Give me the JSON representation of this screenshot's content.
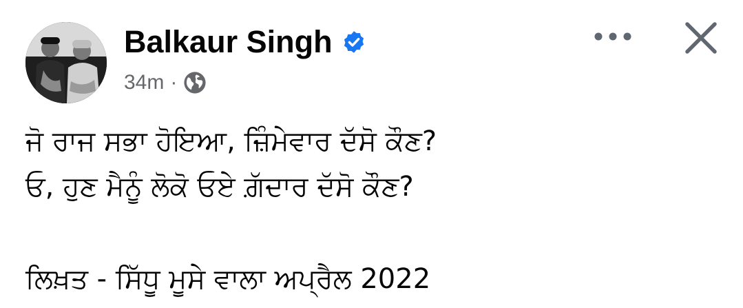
{
  "post": {
    "author_name": "Balkaur Singh",
    "verified": true,
    "timestamp": "34m",
    "separator": "·",
    "audience_icon": "globe-icon",
    "more_icon": "more-options-icon",
    "close_icon": "close-icon",
    "avatar_icon": "profile-photo",
    "body_lines": [
      "ਜੋ ਰਾਜ ਸਭਾ ਹੋਇਆ, ਜ਼ਿੰਮੇਵਾਰ ਦੱਸੋ ਕੌਣ?",
      "ਓ, ਹੁਣ ਮੈਨੂੰ ਲੋਕੋ ਓਏ ਗ਼ੱਦਾਰ ਦੱਸੋ ਕੌਣ?",
      "",
      "ਲਿਖ਼ਤ - ਸਿੱਧੂ ਮੂਸੇ ਵਾਲਾ ਅਪ੍ਰੈਲ 2022"
    ]
  },
  "colors": {
    "text": "#050505",
    "meta": "#65676b",
    "verified_blue": "#1877f2",
    "icon": "#606770"
  }
}
